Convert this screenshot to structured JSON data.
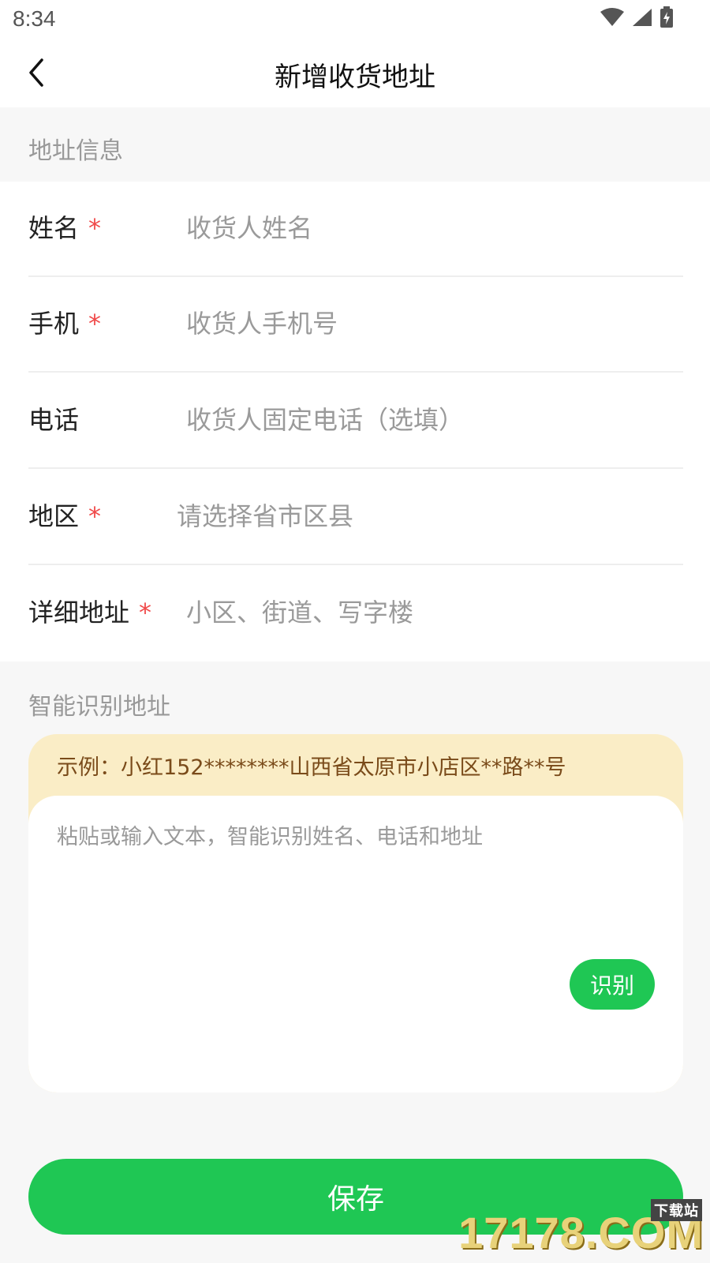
{
  "status_bar": {
    "time": "8:34"
  },
  "nav": {
    "title": "新增收货地址"
  },
  "sections": {
    "address_info": "地址信息",
    "smart_recognize": "智能识别地址"
  },
  "form": {
    "name": {
      "label": "姓名",
      "required": "*",
      "placeholder": "收货人姓名"
    },
    "mobile": {
      "label": "手机",
      "required": "*",
      "placeholder": "收货人手机号"
    },
    "phone": {
      "label": "电话",
      "placeholder": "收货人固定电话（选填）"
    },
    "region": {
      "label": "地区",
      "required": "*",
      "placeholder": "请选择省市区县"
    },
    "detail": {
      "label": "详细地址",
      "required": "*",
      "placeholder": "小区、街道、写字楼"
    }
  },
  "smart": {
    "example": "示例：小红152********山西省太原市小店区**路**号",
    "placeholder": "粘贴或输入文本，智能识别姓名、电话和地址",
    "button": "识别"
  },
  "save_button": "保存",
  "watermark": {
    "main": "17178.COM",
    "small": "下载站"
  },
  "colors": {
    "accent": "#1fc754",
    "required": "#f04a4a",
    "example_bg": "#faedc6",
    "example_text": "#7a4b1a"
  }
}
